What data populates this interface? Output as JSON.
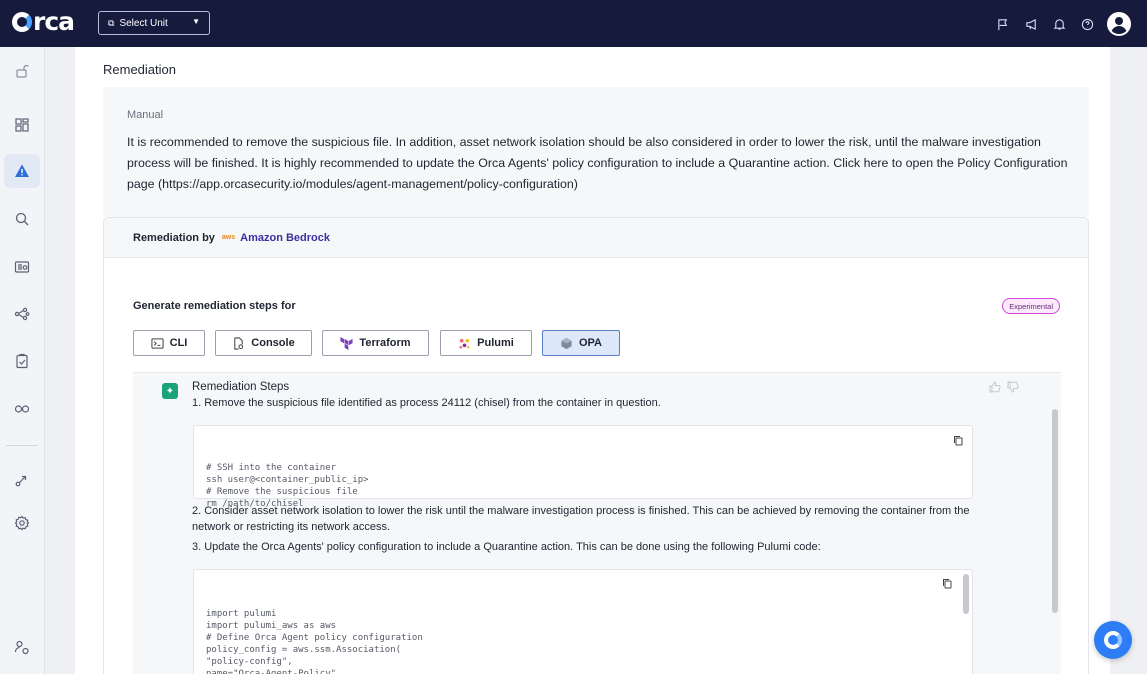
{
  "topbar": {
    "logo": "orca",
    "unit_select": "Select Unit",
    "icons": [
      "flag-icon",
      "megaphone-icon",
      "bell-icon",
      "help-icon",
      "user-avatar-icon"
    ]
  },
  "sidebar": {
    "items": [
      "unlock-icon",
      "dashboard-icon",
      "alerts-icon",
      "search-icon",
      "inventory-icon",
      "graph-icon",
      "compliance-icon",
      "integrations-icon",
      "share-icon",
      "settings-icon",
      "user-settings-icon"
    ],
    "active": "alerts-icon"
  },
  "main": {
    "section_title": "Remediation",
    "manual": {
      "label": "Manual",
      "text": "It is recommended to remove the suspicious file. In addition, asset network isolation should be also considered in order to lower the risk, until the malware investigation process will be finished. It is highly recommended to update the Orca Agents' policy configuration to include a Quarantine action. Click here to open the Policy Configuration page (https://app.orcasecurity.io/modules/agent-management/policy-configuration)"
    },
    "bedrock": {
      "prefix": "Remediation by",
      "aws_mark": "aws",
      "name": "Amazon Bedrock",
      "generate_label": "Generate remediation steps for",
      "badge": "Experimental",
      "tools": [
        "CLI",
        "Console",
        "Terraform",
        "Pulumi",
        "OPA"
      ],
      "selected_tool": "OPA",
      "steps_title": "Remediation Steps",
      "step1": "1. Remove the suspicious file identified as process 24112 (chisel) from the container in question.",
      "code1": "# SSH into the container\nssh user@<container_public_ip>\n# Remove the suspicious file\nrm /path/to/chisel",
      "step2": "2. Consider asset network isolation to lower the risk until the malware investigation process is finished. This can be achieved by removing the container from the network or restricting its network access.",
      "step3": "3. Update the Orca Agents' policy configuration to include a Quarantine action. This can be done using the following Pulumi code:",
      "code2": "import pulumi\nimport pulumi_aws as aws\n# Define Orca Agent policy configuration\npolicy_config = aws.ssm.Association(\n\"policy-config\",\nname=\"Orca-Agent-Policy\",\ntargets=[{"
    }
  },
  "colors": {
    "topbar": "#161b3d",
    "accent": "#3b2fa3",
    "alert": "#2d6fd8",
    "fab": "#2d7df6"
  }
}
